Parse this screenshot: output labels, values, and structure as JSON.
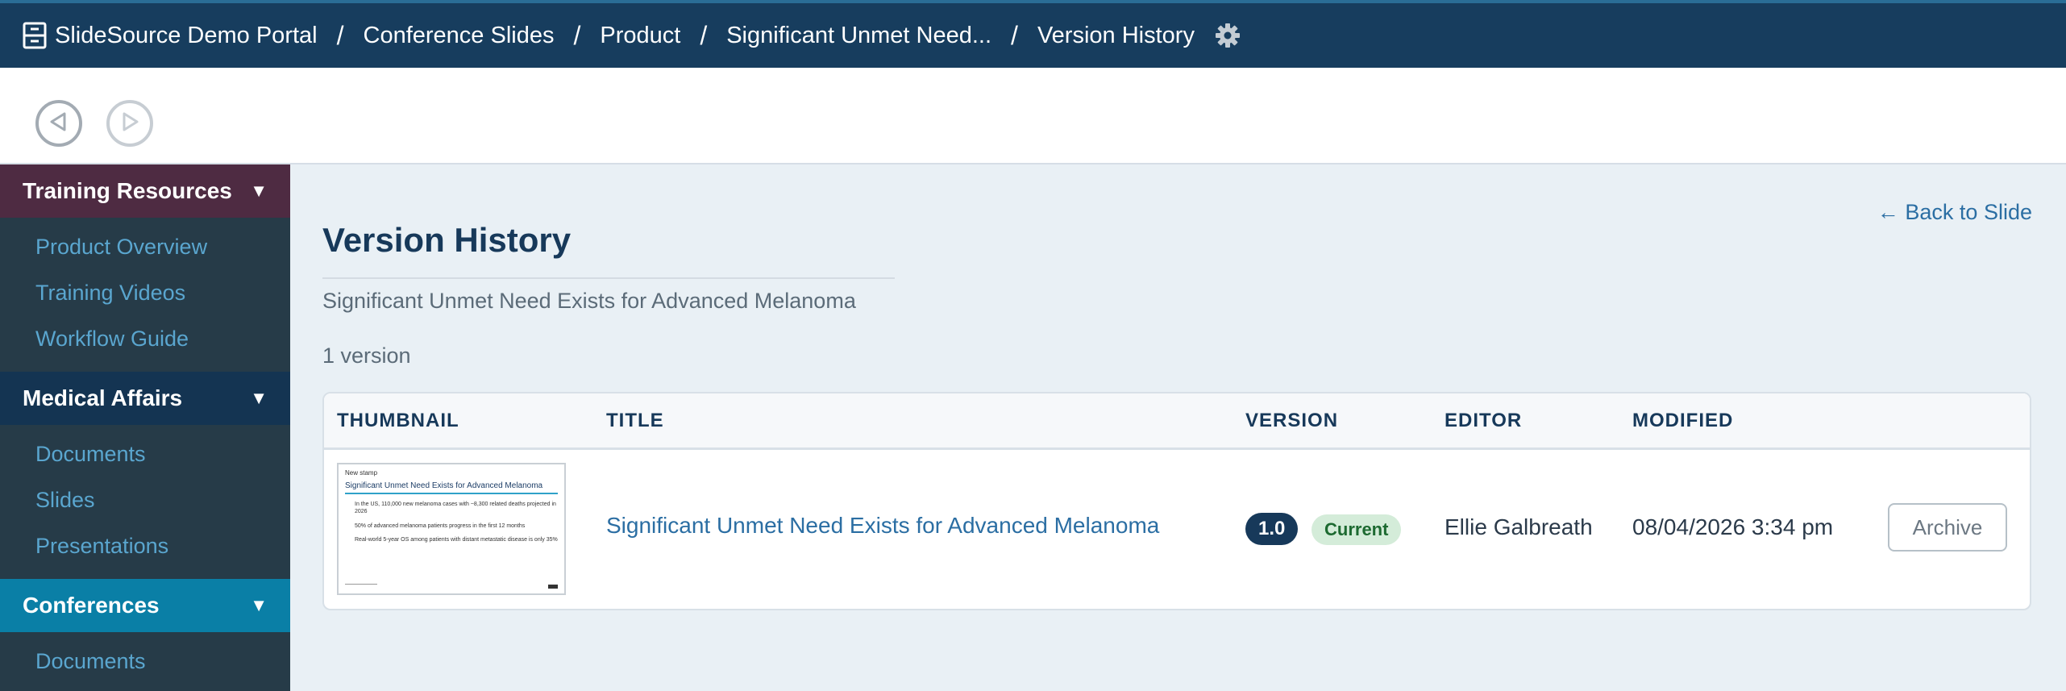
{
  "breadcrumb": {
    "items": [
      "SlideSource Demo Portal",
      "Conference Slides",
      "Product",
      "Significant Unmet Need...",
      "Version History"
    ],
    "separator": "/"
  },
  "sidebar": {
    "sections": [
      {
        "title": "Training Resources",
        "items": [
          "Product Overview",
          "Training Videos",
          "Workflow Guide"
        ]
      },
      {
        "title": "Medical Affairs",
        "items": [
          "Documents",
          "Slides",
          "Presentations"
        ]
      },
      {
        "title": "Conferences",
        "items": [
          "Documents"
        ]
      }
    ],
    "caret": "▼"
  },
  "main": {
    "title": "Version History",
    "subtitle": "Significant Unmet Need Exists for Advanced Melanoma",
    "count": "1 version",
    "back_link": "← Back to Slide",
    "table": {
      "headers": [
        "THUMBNAIL",
        "TITLE",
        "VERSION",
        "EDITOR",
        "MODIFIED"
      ],
      "rows": [
        {
          "thumbnail": {
            "stamp": "New stamp",
            "title": "Significant Unmet Need Exists for Advanced Melanoma",
            "bullets": [
              "In the US, 110,000 new melanoma cases with ~8,300 related deaths projected in 2026",
              "50% of advanced melanoma patients progress in the first 12 months",
              "Real-world 5-year OS among patients with distant metastatic disease is only 35%"
            ]
          },
          "title": "Significant Unmet Need Exists for Advanced Melanoma",
          "version": "1.0",
          "status": "Current",
          "editor": "Ellie Galbreath",
          "modified": "08/04/2026 3:34 pm",
          "action": "Archive"
        }
      ]
    }
  },
  "colors": {
    "topbar": "#173d5e",
    "training": "#4e2b42",
    "medical": "#143452",
    "conferences": "#0a7fa6",
    "link": "#2b6ea3"
  }
}
